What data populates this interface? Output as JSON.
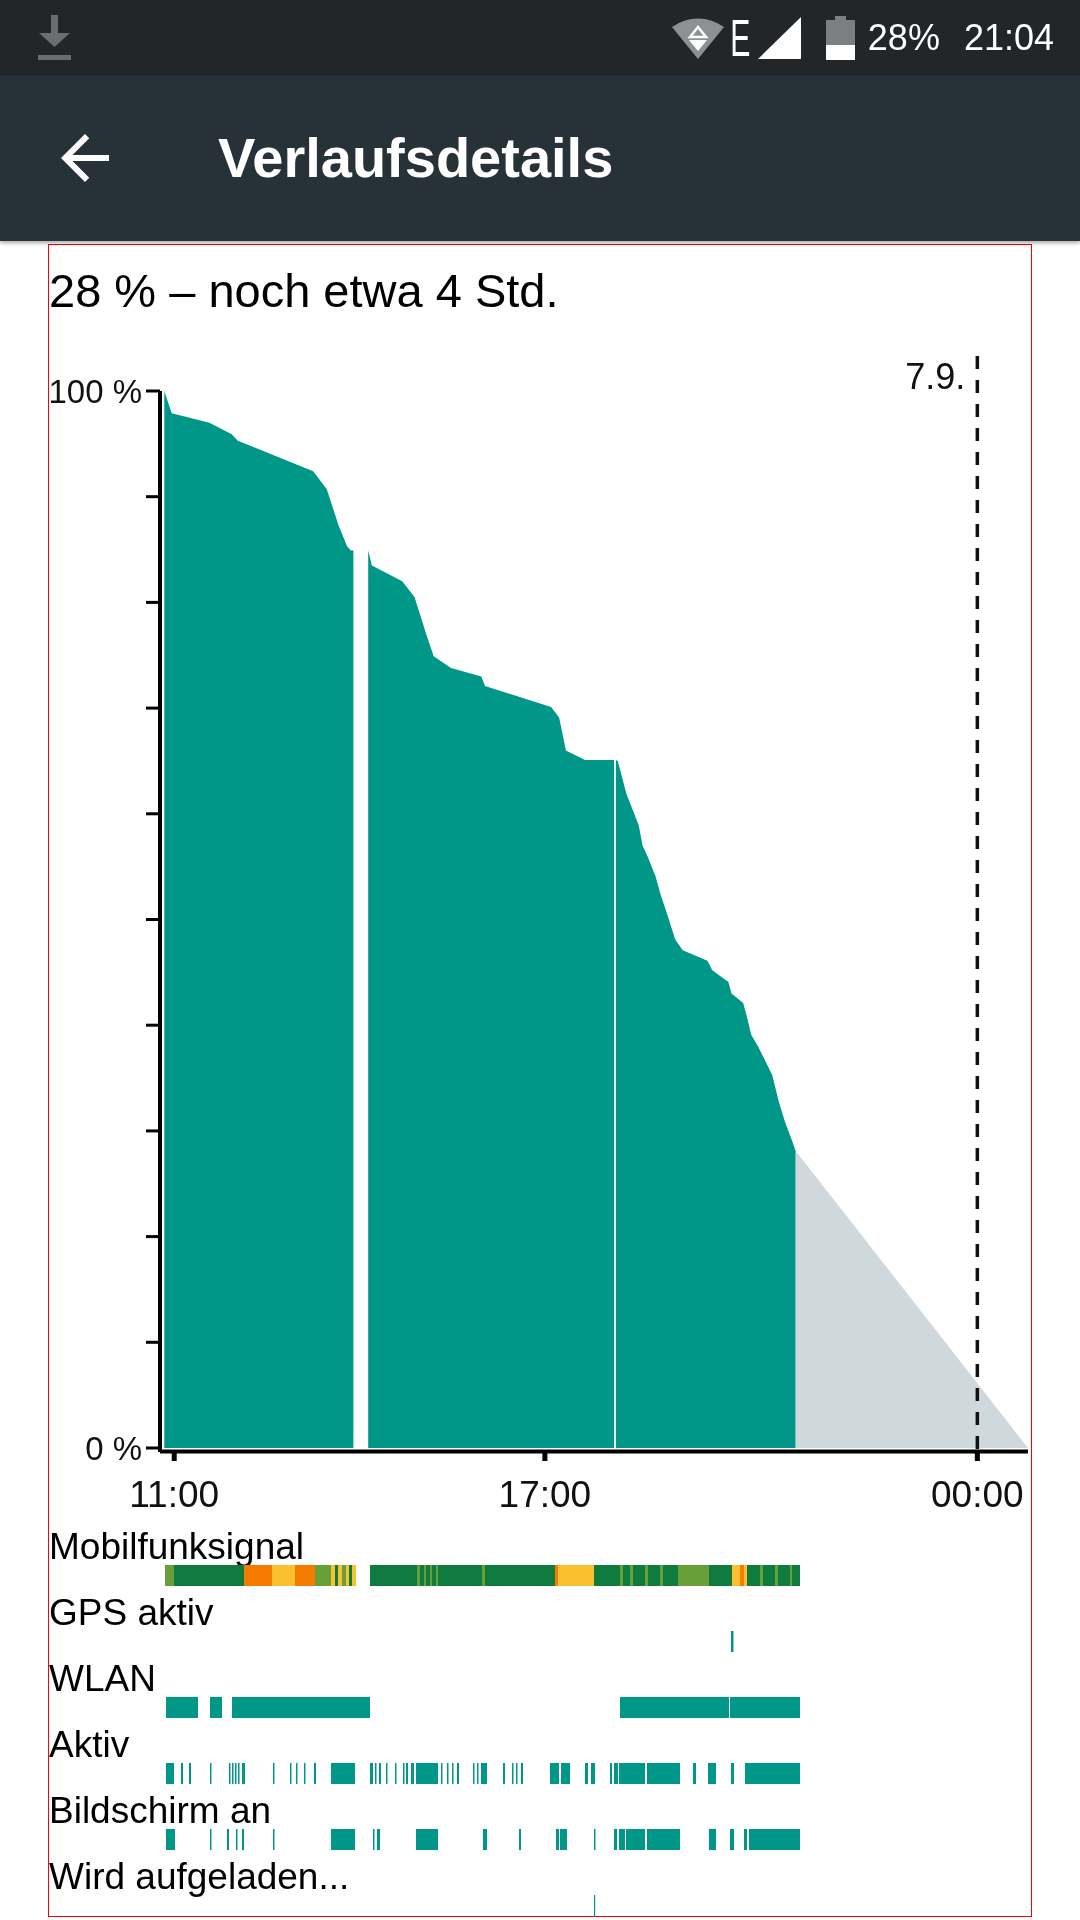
{
  "status_bar": {
    "network_type": "E",
    "battery": "28%",
    "time": "21:04"
  },
  "app_bar": {
    "title": "Verlaufsdetails"
  },
  "history": {
    "summary": "28 % – noch etwa 4 Std.",
    "chart_data": {
      "type": "area",
      "x": [
        10.84,
        10.96,
        11.57,
        11.93,
        12.03,
        13.25,
        13.47,
        13.66,
        13.8,
        13.86,
        13.9,
        14.14,
        14.2,
        14.69,
        14.89,
        15.09,
        15.2,
        15.48,
        15.97,
        16.03,
        17.1,
        17.23,
        17.34,
        17.65,
        18.12,
        18.15,
        18.18,
        18.32,
        18.52,
        18.58,
        18.66,
        18.79,
        18.87,
        18.98,
        19.11,
        19.23,
        19.63,
        19.71,
        19.97,
        20.02,
        20.21,
        20.27,
        20.34,
        20.45,
        20.68,
        20.79,
        20.89,
        21.0,
        21.06,
        24.82
      ],
      "series": [
        {
          "color": "#009688",
          "values": [
            100,
            97.9,
            97.0,
            95.9,
            95.3,
            92.4,
            90.7,
            87.3,
            85.3,
            84.9,
            null,
            84.9,
            83.5,
            82.0,
            80.5,
            76.8,
            74.9,
            73.8,
            73.0,
            72.1,
            70.1,
            69.1,
            66.0,
            65.1,
            null,
            65.1,
            65.0,
            61.9,
            58.9,
            57.0,
            56.0,
            54.1,
            52.4,
            50.5,
            48.1,
            47.1,
            46.1,
            45.2,
            44.1,
            43.0,
            42.1,
            40.8,
            39.1,
            38.0,
            35.3,
            32.7,
            30.8,
            29.1,
            28.1,
            null
          ]
        },
        {
          "color": "#cfd8dc",
          "values": [
            null,
            null,
            null,
            null,
            null,
            null,
            null,
            null,
            null,
            null,
            null,
            null,
            null,
            null,
            null,
            null,
            null,
            null,
            null,
            null,
            null,
            null,
            null,
            null,
            null,
            null,
            null,
            null,
            null,
            null,
            null,
            null,
            null,
            null,
            null,
            null,
            null,
            null,
            null,
            null,
            null,
            null,
            null,
            null,
            null,
            null,
            null,
            null,
            28.1,
            0
          ]
        }
      ],
      "xlim": [
        10.77,
        24.82
      ],
      "ylim": [
        0,
        100
      ],
      "xticks": [
        {
          "value": 11,
          "label": "11:00"
        },
        {
          "value": 17,
          "label": "17:00"
        },
        {
          "value": 24,
          "label": "00:00"
        }
      ],
      "yticks": [
        {
          "value": 0,
          "label": "0 %"
        },
        {
          "value": 100,
          "label": "100 %"
        }
      ],
      "ref_lines": [
        {
          "axis": "x",
          "value": 24
        }
      ],
      "annotations": [
        "7.9."
      ]
    },
    "tracks": [
      {
        "label": "Mobilfunksignal",
        "kind": "signal"
      },
      {
        "label": "GPS aktiv",
        "kind": "bars"
      },
      {
        "label": "WLAN",
        "kind": "bars"
      },
      {
        "label": "Aktiv",
        "kind": "bars"
      },
      {
        "label": "Bildschirm an",
        "kind": "bars"
      },
      {
        "label": "Wird aufgeladen...",
        "kind": "bars"
      }
    ]
  }
}
